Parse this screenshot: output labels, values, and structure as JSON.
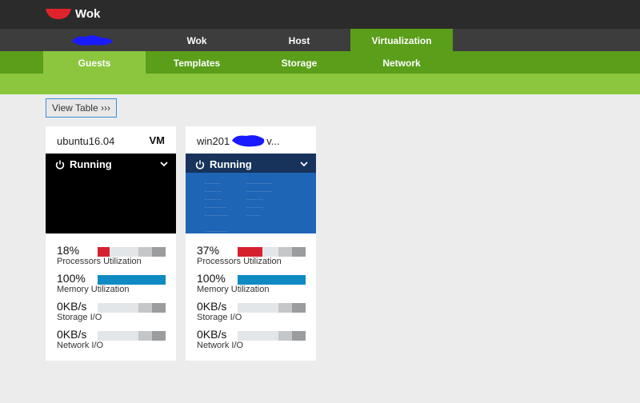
{
  "app": {
    "brand": "Wok"
  },
  "main_nav": {
    "tabs": [
      {
        "label": "Wok",
        "active": false
      },
      {
        "label": "Host",
        "active": false
      },
      {
        "label": "Virtualization",
        "active": true
      }
    ]
  },
  "sub_nav": {
    "tabs": [
      {
        "label": "Guests",
        "active": true
      },
      {
        "label": "Templates",
        "active": false
      },
      {
        "label": "Storage",
        "active": false
      },
      {
        "label": "Network",
        "active": false
      }
    ]
  },
  "toolbar": {
    "view_table_label": "View Table ›››"
  },
  "guests": [
    {
      "name": "ubuntu16.04",
      "badge": "VM",
      "status": "Running",
      "cpu": {
        "value": "18%",
        "label": "Processors Utilization",
        "fraction": 0.18
      },
      "memory": {
        "value": "100%",
        "label": "Memory Utilization",
        "fraction": 1.0
      },
      "storage": {
        "value": "0KB/s",
        "label": "Storage I/O",
        "fraction": 0
      },
      "network": {
        "value": "0KB/s",
        "label": "Network I/O",
        "fraction": 0
      }
    },
    {
      "name": "win201",
      "name_tail": "v...",
      "badge": "",
      "status": "Running",
      "cpu": {
        "value": "37%",
        "label": "Processors Utilization",
        "fraction": 0.37
      },
      "memory": {
        "value": "100%",
        "label": "Memory Utilization",
        "fraction": 1.0
      },
      "storage": {
        "value": "0KB/s",
        "label": "Storage I/O",
        "fraction": 0
      },
      "network": {
        "value": "0KB/s",
        "label": "Network I/O",
        "fraction": 0
      }
    }
  ],
  "colors": {
    "topbar": "#2b2b2b",
    "main_nav": "#3d3d3d",
    "green_dark": "#5a9e1a",
    "green_light": "#8cc63f",
    "cpu_bar": "#d6202f",
    "memory_bar": "#0f8ac2",
    "windows_screen": "#1f65b5",
    "ubuntu_screen": "#000000"
  }
}
